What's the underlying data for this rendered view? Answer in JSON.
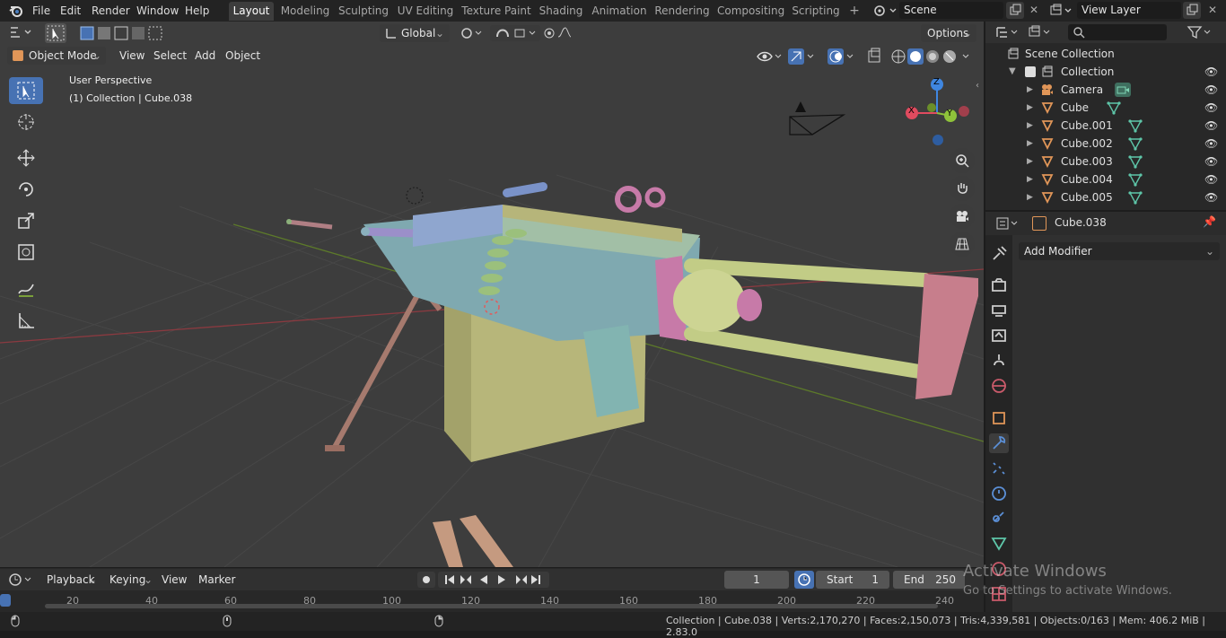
{
  "topbar": {
    "menus": [
      "File",
      "Edit",
      "Render",
      "Window",
      "Help"
    ],
    "workspaces": [
      "Layout",
      "Modeling",
      "Sculpting",
      "UV Editing",
      "Texture Paint",
      "Shading",
      "Animation",
      "Rendering",
      "Compositing",
      "Scripting"
    ],
    "add_tab": "+",
    "scene_value": "Scene",
    "view_layer_value": "View Layer"
  },
  "viewport_header": {
    "orientation": "Global",
    "options": "Options",
    "mode": "Object Mode",
    "menus": [
      "View",
      "Select",
      "Add",
      "Object"
    ]
  },
  "viewport": {
    "perspective": "User Perspective",
    "collection_info": "(1) Collection | Cube.038",
    "gizmo_axes": {
      "x": "X",
      "y": "Y",
      "z": "Z"
    },
    "axis_colors": {
      "x": "#e04b5f",
      "y": "#8fc23a",
      "z": "#3f86e0"
    }
  },
  "outliner": {
    "scene_collection": "Scene Collection",
    "collection": "Collection",
    "objects": [
      "Camera",
      "Cube",
      "Cube.001",
      "Cube.002",
      "Cube.003",
      "Cube.004",
      "Cube.005"
    ]
  },
  "properties": {
    "object_name": "Cube.038",
    "add_modifier": "Add Modifier"
  },
  "timeline": {
    "menus": [
      "Playback",
      "Keying",
      "View",
      "Marker"
    ],
    "current_frame": "1",
    "start_label": "Start",
    "start_value": "1",
    "end_label": "End",
    "end_value": "250",
    "ticks": [
      "20",
      "40",
      "60",
      "80",
      "100",
      "120",
      "140",
      "160",
      "180",
      "200",
      "220",
      "240"
    ]
  },
  "watermark": {
    "title": "Activate Windows",
    "subtitle": "Go to Settings to activate Windows."
  },
  "statusbar": {
    "stats": "Collection | Cube.038 | Verts:2,170,270 | Faces:2,150,073 | Tris:4,339,581 | Objects:0/163 | Mem: 406.2 MiB | 2.83.0"
  },
  "colors": {
    "accent": "#4772b3",
    "viewport_bg": "#3d3d3d",
    "panel_bg": "#2b2b2b"
  }
}
